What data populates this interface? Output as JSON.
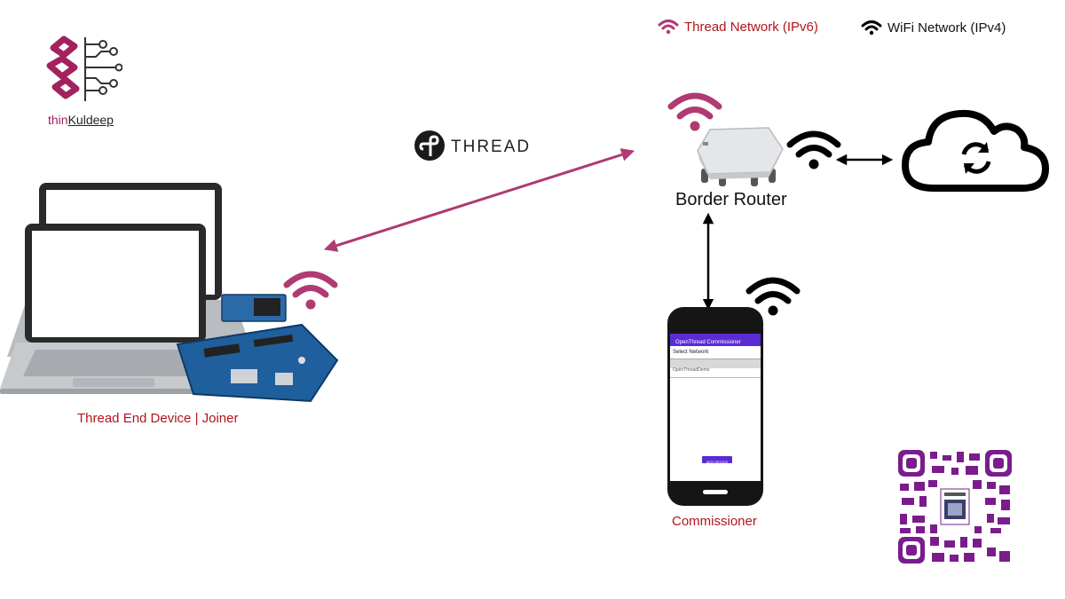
{
  "legend": {
    "thread_label": "Thread Network (IPv6)",
    "wifi_label": "WiFi Network (IPv4)"
  },
  "brand": {
    "prefix": "thin",
    "suffix": "Kuldeep"
  },
  "thread_logo_text": "THREAD",
  "nodes": {
    "border_router": "Border Router",
    "end_device": "Thread End Device | Joiner",
    "commissioner": "Commissioner"
  },
  "phone_screen": {
    "app_title": "OpenThread Commissioner",
    "section": "Select Network",
    "network_name": "OpenThreadDemo",
    "button_label": "ADD DEVICE"
  },
  "colors": {
    "thread": "#b03a72",
    "wifi": "#000000",
    "label_red": "#b0151c",
    "brand": "#a2215e",
    "qr": "#7a1c8c",
    "app_bar": "#5b2bd6"
  },
  "icons": [
    "brain-circuit-logo-icon",
    "thread-logo-icon",
    "wifi-icon",
    "cloud-sync-icon",
    "laptop-icon",
    "dev-board-icon",
    "phone-icon",
    "border-router-icon",
    "qr-code-icon"
  ]
}
